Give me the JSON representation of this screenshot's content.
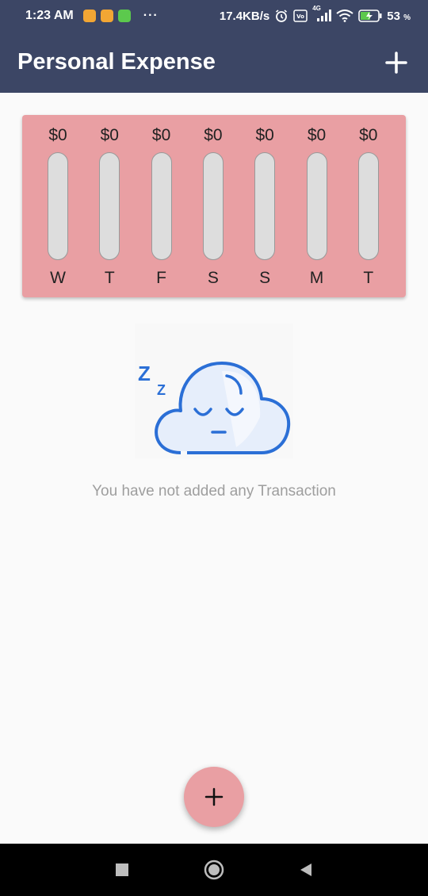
{
  "status_bar": {
    "time": "1:23 AM",
    "more": "···",
    "speed": "17.4KB/s",
    "network": "4G",
    "battery": "53"
  },
  "app_bar": {
    "title": "Personal Expense"
  },
  "chart": {
    "days": [
      {
        "label": "W",
        "amount": "$0",
        "fraction": 0
      },
      {
        "label": "T",
        "amount": "$0",
        "fraction": 0
      },
      {
        "label": "F",
        "amount": "$0",
        "fraction": 0
      },
      {
        "label": "S",
        "amount": "$0",
        "fraction": 0
      },
      {
        "label": "S",
        "amount": "$0",
        "fraction": 0
      },
      {
        "label": "M",
        "amount": "$0",
        "fraction": 0
      },
      {
        "label": "T",
        "amount": "$0",
        "fraction": 0
      }
    ]
  },
  "empty_state": {
    "message": "You have not added any Transaction",
    "icon": "sleeping-cloud-icon"
  },
  "colors": {
    "app_bar": "#3c4665",
    "card": "#e99fa3",
    "track": "#dddddd",
    "illustration": "#2b6fd6"
  }
}
